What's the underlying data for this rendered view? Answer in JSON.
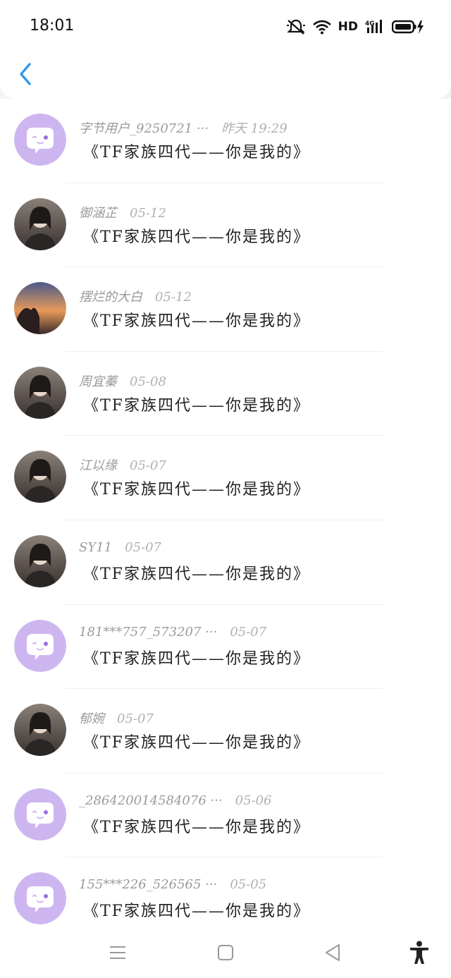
{
  "status_bar": {
    "time": "18:01",
    "network": "HD",
    "signal_type": "4G",
    "icons": [
      "mute-bell-icon",
      "wifi-icon",
      "signal-icon",
      "battery-charging-icon"
    ]
  },
  "header": {
    "back_icon": "chevron-left-icon"
  },
  "comments": [
    {
      "user": "字节用户_9250721 ···",
      "time": "昨天 19:29",
      "message": "《TF家族四代——你是我的》",
      "avatar": "default"
    },
    {
      "user": "御涵芷",
      "time": "05-12",
      "message": "《TF家族四代——你是我的》",
      "avatar": "photo"
    },
    {
      "user": "摆烂的大白",
      "time": "05-12",
      "message": "《TF家族四代——你是我的》",
      "avatar": "sunset"
    },
    {
      "user": "周宜蓁",
      "time": "05-08",
      "message": "《TF家族四代——你是我的》",
      "avatar": "photo"
    },
    {
      "user": "江以缘",
      "time": "05-07",
      "message": "《TF家族四代——你是我的》",
      "avatar": "photo"
    },
    {
      "user": "SY11",
      "time": "05-07",
      "message": "《TF家族四代——你是我的》",
      "avatar": "photo"
    },
    {
      "user": "181***757_573207 ···",
      "time": "05-07",
      "message": "《TF家族四代——你是我的》",
      "avatar": "default"
    },
    {
      "user": "郁婉",
      "time": "05-07",
      "message": "《TF家族四代——你是我的》",
      "avatar": "photo"
    },
    {
      "user": "_286420014584076 ···",
      "time": "05-06",
      "message": "《TF家族四代——你是我的》",
      "avatar": "default"
    },
    {
      "user": "155***226_526565 ···",
      "time": "05-05",
      "message": "《TF家族四代——你是我的》",
      "avatar": "default"
    }
  ],
  "navbar": {
    "items": [
      "menu-icon",
      "home-square-icon",
      "back-triangle-icon",
      "accessibility-icon"
    ]
  },
  "colors": {
    "accent": "#2f9be8",
    "default_avatar": "#cdb6f0",
    "name_text": "#9a9a9a",
    "message_text": "#222222"
  }
}
